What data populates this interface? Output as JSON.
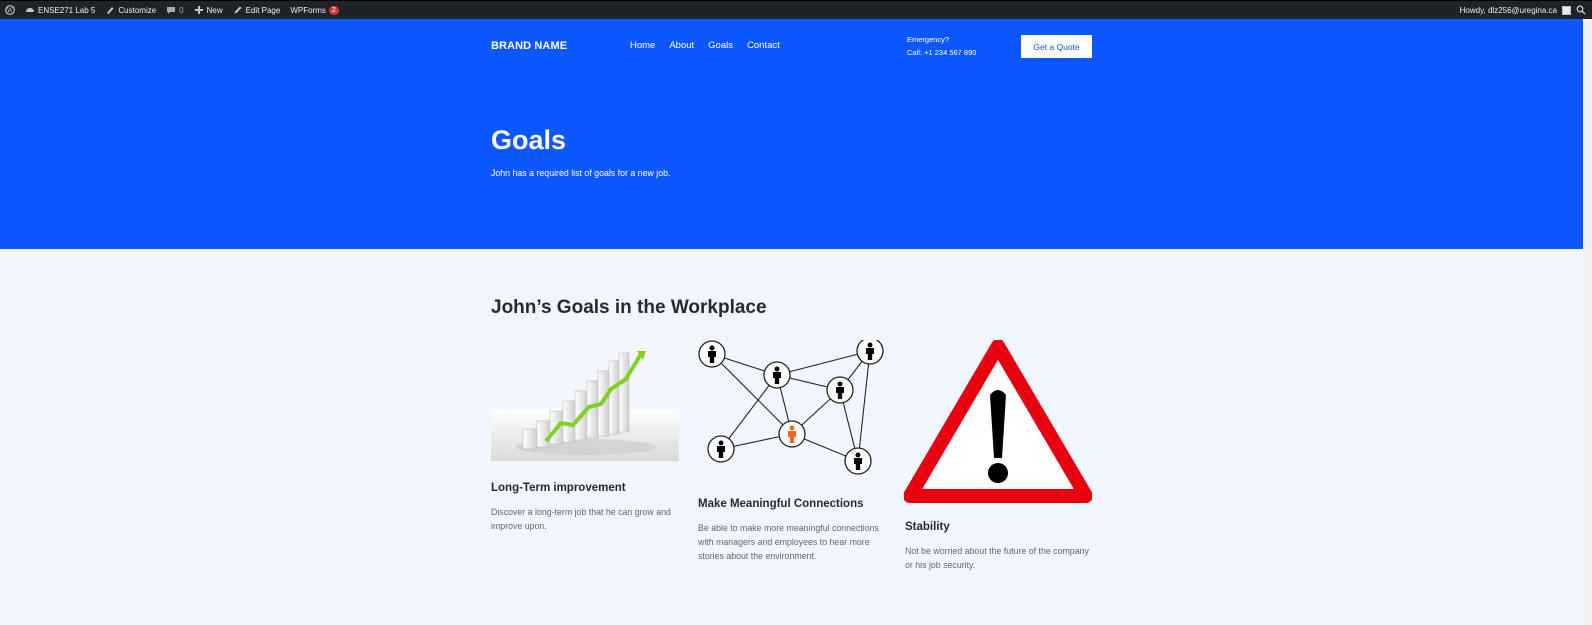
{
  "adminbar": {
    "site_name": "ENSE271 Lab 5",
    "customize": "Customize",
    "comments_count": "0",
    "new": "New",
    "edit_page": "Edit Page",
    "wpforms": "WPForms",
    "wpforms_badge": "2",
    "howdy": "Howdy, dlz256@uregina.ca"
  },
  "header": {
    "brand": "BRAND NAME",
    "nav": [
      "Home",
      "About",
      "Goals",
      "Contact"
    ],
    "emergency_label": "Emergency?",
    "emergency_phone": "Call: +1 234 567 890",
    "quote_button": "Get a Quote"
  },
  "hero": {
    "title": "Goals",
    "subtitle": "John has a required list of goals for a new job."
  },
  "main": {
    "section_title": "John’s Goals in the Workplace",
    "cards": [
      {
        "title": "Long-Term improvement",
        "text": "Discover a long-term job that he can grow and improve upon.",
        "icon": "growth-chart-icon"
      },
      {
        "title": "Make Meaningful Connections",
        "text": "Be able to make more meaningful connections with managers and employees to hear more stories about the environment.",
        "icon": "network-icon"
      },
      {
        "title": "Stability",
        "text": "Not be worried about the future of the company or his job security.",
        "icon": "warning-icon"
      }
    ]
  },
  "colors": {
    "hero_blue": "#0d57ff",
    "page_bg": "#f2f7ff",
    "heading": "#262b33",
    "warning_red": "#e8000e",
    "chart_green": "#7ed321",
    "highlight_orange": "#f26b1d"
  }
}
